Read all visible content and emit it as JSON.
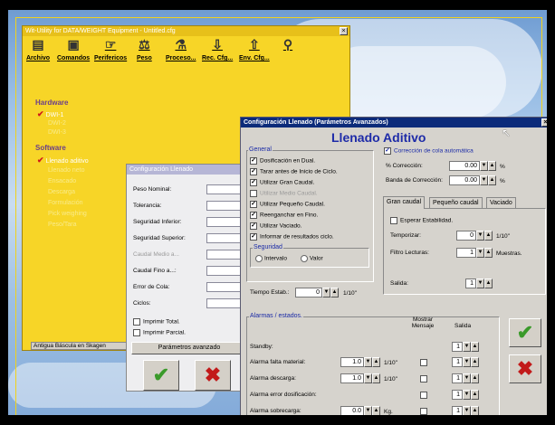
{
  "main": {
    "title": "Wit-Utility for DATA/WEIGHT Equipment - Untitled.cfg",
    "close": "×",
    "toolbar": [
      {
        "label": "Archivo",
        "icon": "archive-icon",
        "glyph": "▤"
      },
      {
        "label": "Comandos",
        "icon": "commands-icon",
        "glyph": "▣"
      },
      {
        "label": "Perifericos",
        "icon": "peripherals-icon",
        "glyph": "☞"
      },
      {
        "label": "Peso",
        "icon": "weight-icon",
        "glyph": "⚖"
      },
      {
        "label": "Proceso...",
        "icon": "process-icon",
        "glyph": "⚗"
      },
      {
        "label": "Rec. Cfg...",
        "icon": "receive-config-icon",
        "glyph": "⇩"
      },
      {
        "label": "Env. Cfg...",
        "icon": "send-config-icon",
        "glyph": "⇧"
      },
      {
        "label": "",
        "icon": "network-icon",
        "glyph": "⚲"
      }
    ],
    "tree": {
      "hardware": "Hardware",
      "hw_items": [
        "DWI-1",
        "DWI-2",
        "DWI-3"
      ],
      "software": "Software",
      "sw_items": [
        "Llenado aditivo",
        "Llenado neto",
        "Ensacado",
        "Descarga",
        "Formulación",
        "Pick weighing",
        "Peso/Tara"
      ]
    },
    "status": "Antigua Báscula en Skagen"
  },
  "cfg": {
    "title": "Configuración Llenado",
    "fields": [
      {
        "label": "Peso Nominal:",
        "value": "0"
      },
      {
        "label": "Tolerancia:",
        "value": "0"
      },
      {
        "label": "Seguridad Inferior:",
        "value": "0"
      },
      {
        "label": "Seguridad Superior:",
        "value": "0"
      },
      {
        "label": "Caudal Medio a...",
        "value": "0"
      },
      {
        "label": "Caudal Fino a...:",
        "value": "0"
      },
      {
        "label": "Error de Cola:",
        "value": "0"
      },
      {
        "label": "Ciclos:",
        "value": "0"
      }
    ],
    "imprimir_total": "Imprimir Total.",
    "imprimir_parcial": "Imprimir Parcial.",
    "advanced_button": "Parámetros avanzado"
  },
  "adv": {
    "title": "Configuración Llenado (Parámetros Avanzados)",
    "close": "×",
    "heading": "Llenado Aditivo",
    "general_label": "General",
    "general_items": [
      {
        "label": "Dosificación en Dual.",
        "checked": true
      },
      {
        "label": "Tarar antes de Inicio de Ciclo.",
        "checked": true
      },
      {
        "label": "Utilizar Gran Caudal.",
        "checked": true
      },
      {
        "label": "Utilizar Medio Caudal.",
        "checked": false
      },
      {
        "label": "Utilizar Pequeño Caudal.",
        "checked": true
      },
      {
        "label": "Reenganchar en Fino.",
        "checked": true
      },
      {
        "label": "Utilizar Vaciado.",
        "checked": true
      },
      {
        "label": "Informar de resultados ciclo.",
        "checked": true
      }
    ],
    "seguridad_label": "Seguridad",
    "intervalo": "Intervalo",
    "valor": "Valor",
    "tiempo_label": "Tiempo Estab.:",
    "tiempo_value": "0",
    "tiempo_unit": "1/10\"",
    "correccion_cola": "Corrección de cola automática",
    "pct_correccion_label": "% Corrección:",
    "pct_correccion_value": "0.00",
    "pct_unit": "%",
    "banda_label": "Banda de Corrección:",
    "banda_value": "0.00",
    "banda_unit": "%",
    "tabs": [
      "Gran caudal",
      "Pequeño caudal",
      "Vaciado"
    ],
    "esperar": "Esperar Estabilidad.",
    "temporizar_label": "Temporizar:",
    "temporizar_value": "0",
    "temporizar_unit": "1/10\"",
    "filtro_label": "Filtro Lecturas:",
    "filtro_value": "1",
    "filtro_unit": "Muestras.",
    "salida_label": "Salida:",
    "salida_value": "1",
    "alarmas_label": "Alarmas / estados.",
    "mostrar_header": "Mostrar Mensaje",
    "salida_header": "Salida",
    "alarms": [
      {
        "label": "Standby:",
        "value": "",
        "unit": "",
        "out": "1"
      },
      {
        "label": "Alarma falta material:",
        "value": "1.0",
        "unit": "1/10\"",
        "out": "1"
      },
      {
        "label": "Alarma descarga:",
        "value": "1.0",
        "unit": "1/10\"",
        "out": "1"
      },
      {
        "label": "Alarma error dosificación:",
        "value": "",
        "unit": "",
        "out": "1"
      },
      {
        "label": "Alarma sobrecarga:",
        "value": "0.0",
        "unit": "Kg.",
        "out": "1"
      }
    ],
    "ok": "✔",
    "cancel": "✖"
  }
}
